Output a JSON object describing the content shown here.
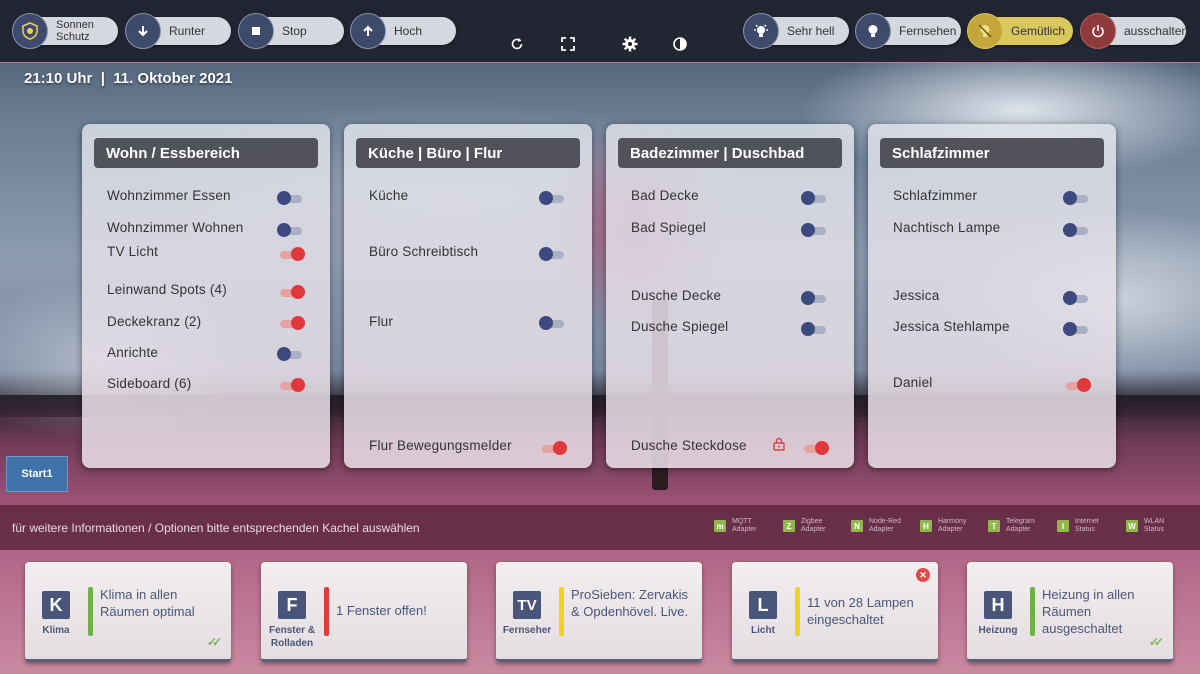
{
  "topbar": {
    "left_buttons": [
      {
        "label": "Sonnen\nSchutz",
        "icon": "sun-shield-icon"
      },
      {
        "label": "Runter",
        "icon": "arrow-down-icon"
      },
      {
        "label": "Stop",
        "icon": "stop-icon"
      },
      {
        "label": "Hoch",
        "icon": "arrow-up-icon"
      }
    ],
    "center_icons": [
      "refresh-icon",
      "fullscreen-icon",
      "gear-icon",
      "contrast-icon"
    ],
    "right_buttons": [
      {
        "label": "Sehr hell",
        "icon": "bright-bulb-icon"
      },
      {
        "label": "Fernsehen",
        "icon": "bulb-icon"
      },
      {
        "label": "Gemütlich",
        "icon": "bulb-off-icon"
      },
      {
        "label": "ausschalten",
        "icon": "power-icon"
      }
    ]
  },
  "datetime": "21:10 Uhr  |  11. Oktober 2021",
  "rooms": [
    {
      "title": "Wohn / Essbereich",
      "items": [
        {
          "label": "Wohnzimmer Essen",
          "on": false
        },
        {
          "label": "Wohnzimmer Wohnen",
          "on": false
        },
        {
          "label": "TV Licht",
          "on": true
        },
        {
          "label": "Leinwand Spots (4)",
          "on": true
        },
        {
          "label": "Deckekranz (2)",
          "on": true
        },
        {
          "label": "Anrichte",
          "on": false
        },
        {
          "label": "Sideboard (6)",
          "on": true
        }
      ]
    },
    {
      "title": "Küche | Büro | Flur",
      "items": [
        {
          "label": "Küche",
          "on": false
        },
        {
          "label": "Büro Schreibtisch",
          "on": false
        },
        {
          "label": "Flur",
          "on": false
        },
        {
          "label": "Flur Bewegungsmelder",
          "on": true
        }
      ]
    },
    {
      "title": "Badezimmer | Duschbad",
      "items": [
        {
          "label": "Bad Decke",
          "on": false
        },
        {
          "label": "Bad Spiegel",
          "on": false
        },
        {
          "label": "Dusche Decke",
          "on": false
        },
        {
          "label": "Dusche Spiegel",
          "on": false
        },
        {
          "label": "Dusche Steckdose",
          "on": true,
          "locked": true
        }
      ]
    },
    {
      "title": "Schlafzimmer",
      "items": [
        {
          "label": "Schlafzimmer",
          "on": false
        },
        {
          "label": "Nachtisch Lampe",
          "on": false
        },
        {
          "label": "Jessica",
          "on": false
        },
        {
          "label": "Jessica Stehlampe",
          "on": false
        },
        {
          "label": "Daniel",
          "on": true
        }
      ]
    }
  ],
  "start_button": "Start1",
  "infobar": {
    "text": "für weitere Informationen / Optionen bitte entsprechenden Kachel auswählen",
    "statuses": [
      {
        "letter": "m",
        "label": "MQTT\nAdapter"
      },
      {
        "letter": "Z",
        "label": "Zigbee\nAdapter"
      },
      {
        "letter": "N",
        "label": "Node-Red\nAdapter"
      },
      {
        "letter": "H",
        "label": "Harmony\nAdapter"
      },
      {
        "letter": "T",
        "label": "Telegram\nAdapter"
      },
      {
        "letter": "I",
        "label": "Internet\nStatus"
      },
      {
        "letter": "W",
        "label": "WLAN\nStatus"
      }
    ]
  },
  "tiles": [
    {
      "letter": "K",
      "caption": "Klima",
      "text": "Klima in allen Räumen optimal",
      "bar_color": "#6fb04a",
      "check": true,
      "alert": false
    },
    {
      "letter": "F",
      "caption": "Fenster & Rolladen",
      "text": "1 Fenster offen!",
      "bar_color": "#e23b3b",
      "check": false,
      "alert": false
    },
    {
      "letter": "TV",
      "caption": "Fernseher",
      "text": "ProSieben: Zervakis & Opdenhövel. Live.",
      "bar_color": "#f1d21d",
      "check": false,
      "alert": false
    },
    {
      "letter": "L",
      "caption": "Licht",
      "text": "11 von 28 Lampen eingeschaltet",
      "bar_color": "#f1d21d",
      "check": false,
      "alert": true
    },
    {
      "letter": "H",
      "caption": "Heizung",
      "text": "Heizung in allen Räumen ausgeschaltet",
      "bar_color": "#6fb04a",
      "check": true,
      "alert": false
    }
  ]
}
